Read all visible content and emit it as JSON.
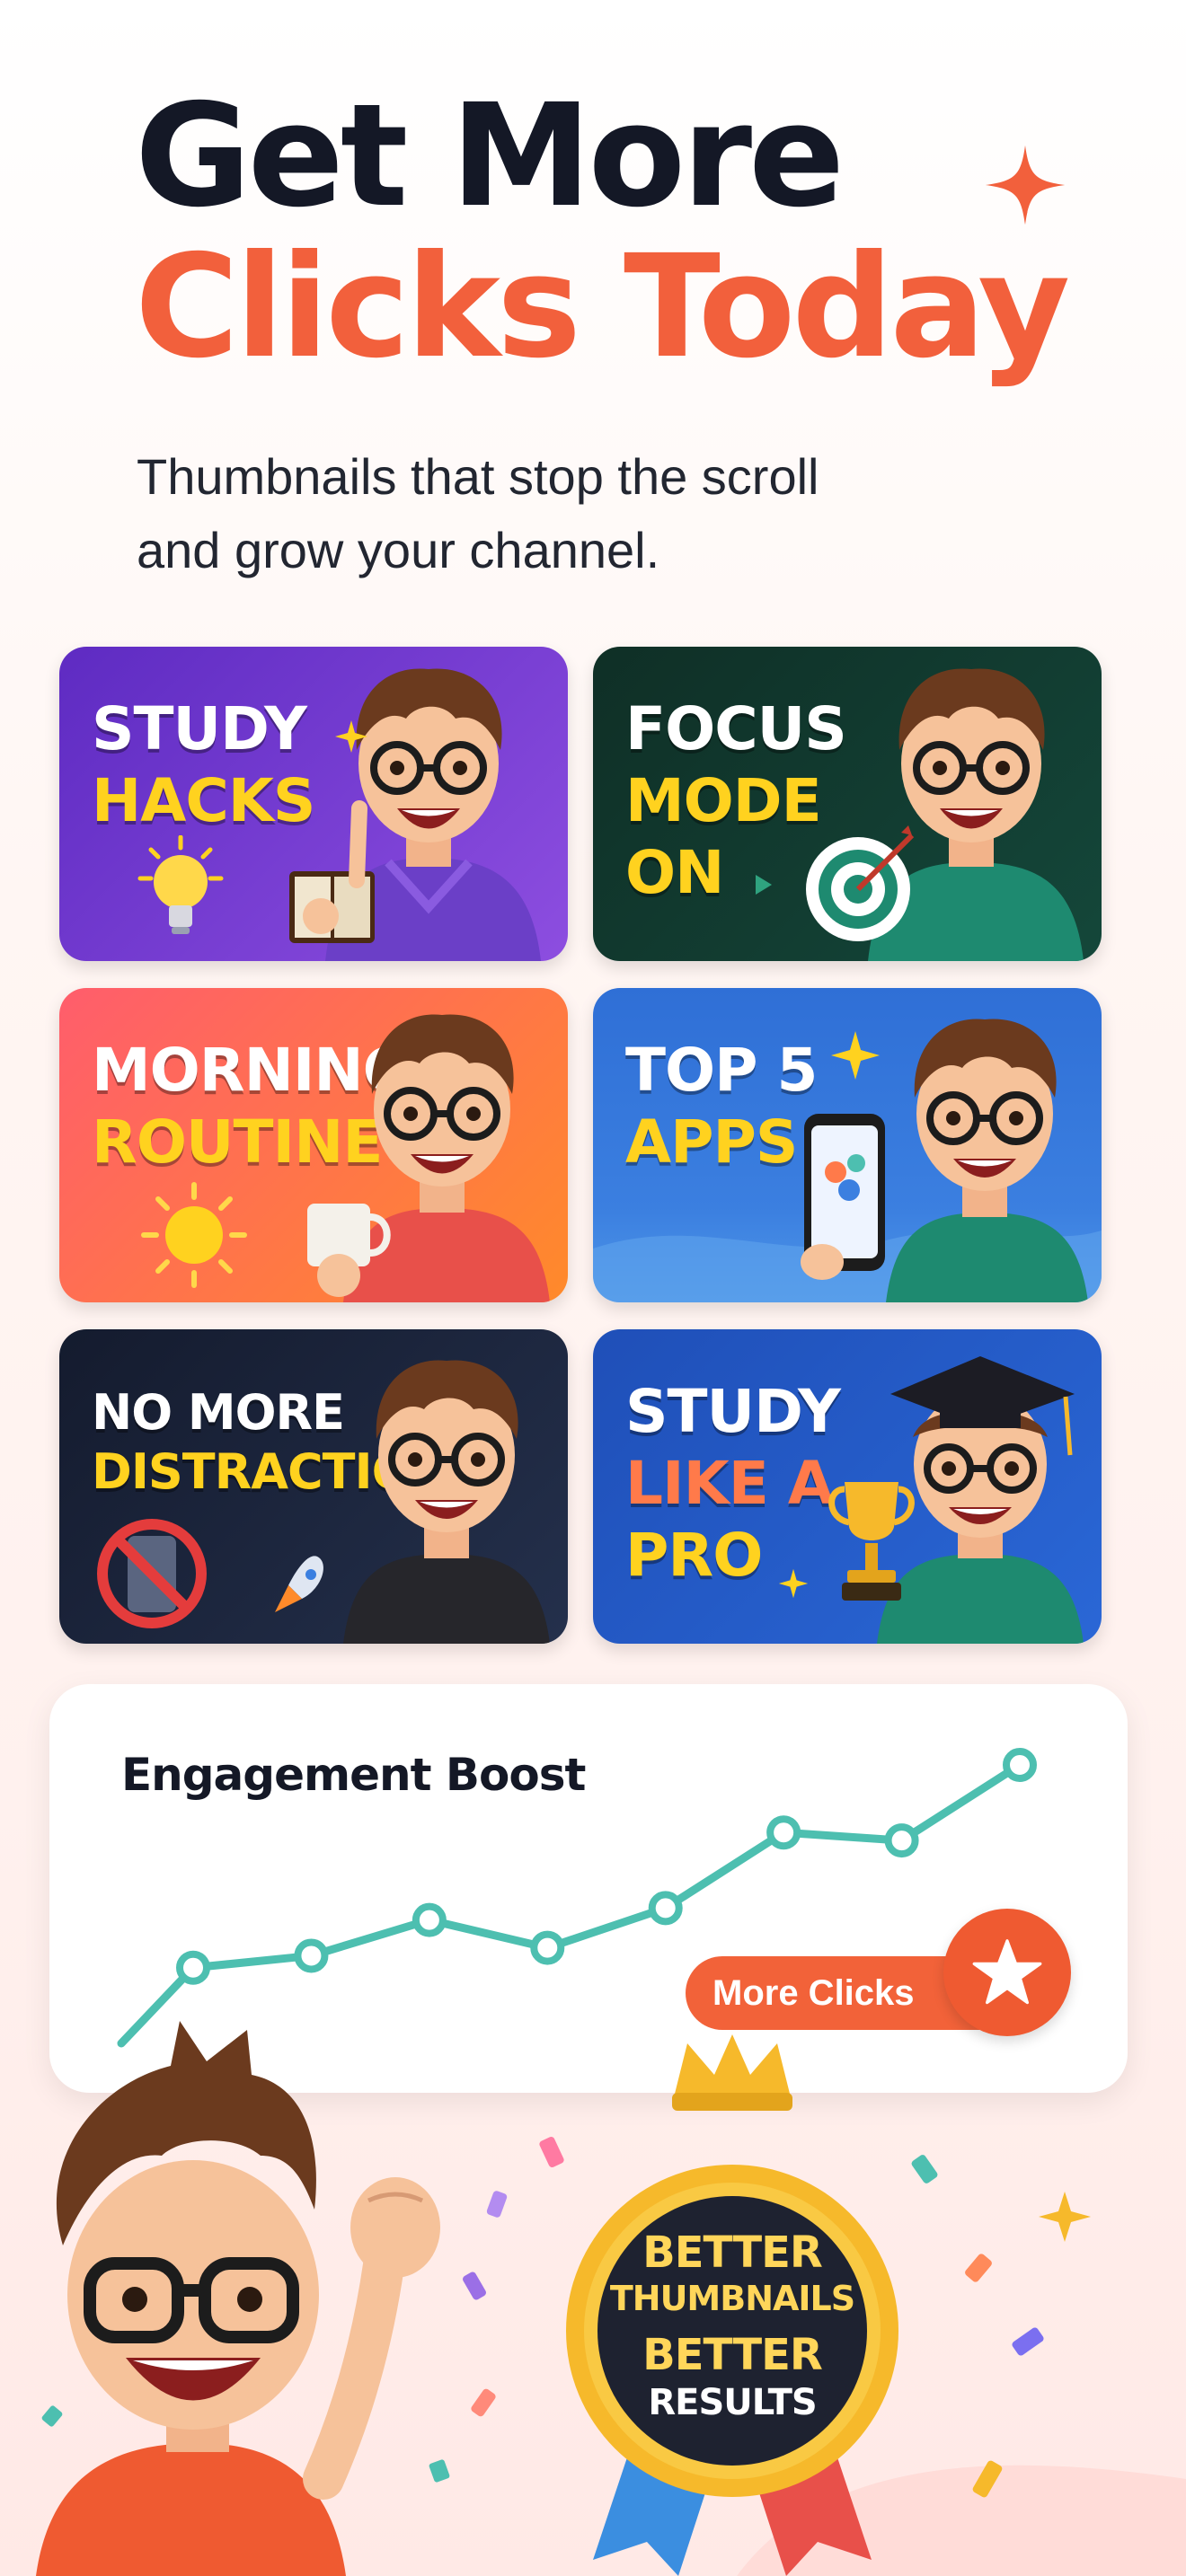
{
  "header": {
    "title_line1": "Get More",
    "title_line2": "Clicks Today",
    "subtitle_line1": "Thumbnails that stop the scroll",
    "subtitle_line2": "and grow your channel."
  },
  "thumbnails": [
    {
      "lines": [
        "STUDY",
        "HACKS"
      ],
      "colors": [
        "#ffffff",
        "#ffd21f"
      ],
      "icon": "lightbulb-icon"
    },
    {
      "lines": [
        "FOCUS",
        "MODE",
        "ON"
      ],
      "colors": [
        "#ffffff",
        "#ffd21f",
        "#ffd21f"
      ],
      "icon": "target-icon"
    },
    {
      "lines": [
        "MORNING",
        "ROUTINE"
      ],
      "colors": [
        "#ffffff",
        "#ffd21f"
      ],
      "icon": "sun-icon"
    },
    {
      "lines": [
        "TOP 5",
        "APPS"
      ],
      "colors": [
        "#ffffff",
        "#ffd21f"
      ],
      "icon": "phone-icon"
    },
    {
      "lines": [
        "NO MORE",
        "DISTRACTIONS"
      ],
      "colors": [
        "#ffffff",
        "#ffd21f"
      ],
      "icon": "no-phone-icon"
    },
    {
      "lines": [
        "STUDY",
        "LIKE A",
        "PRO"
      ],
      "colors": [
        "#ffffff",
        "#ff7a4a",
        "#ffd21f"
      ],
      "icon": "trophy-icon"
    }
  ],
  "engagement": {
    "title": "Engagement Boost",
    "pill_label": "More Clicks",
    "icon": "star-icon",
    "trend": [
      1,
      1.3,
      2.2,
      1.5,
      2.5,
      4.4,
      4.2,
      6.1
    ]
  },
  "badge": {
    "line1": "BETTER",
    "line2": "THUMBNAILS",
    "line3": "BETTER",
    "line4": "RESULTS",
    "icon": "crown-icon"
  },
  "colors": {
    "accent": "#f2603c",
    "dark": "#141826",
    "teal": "#4dbfb0",
    "gold": "#f6b92b"
  }
}
